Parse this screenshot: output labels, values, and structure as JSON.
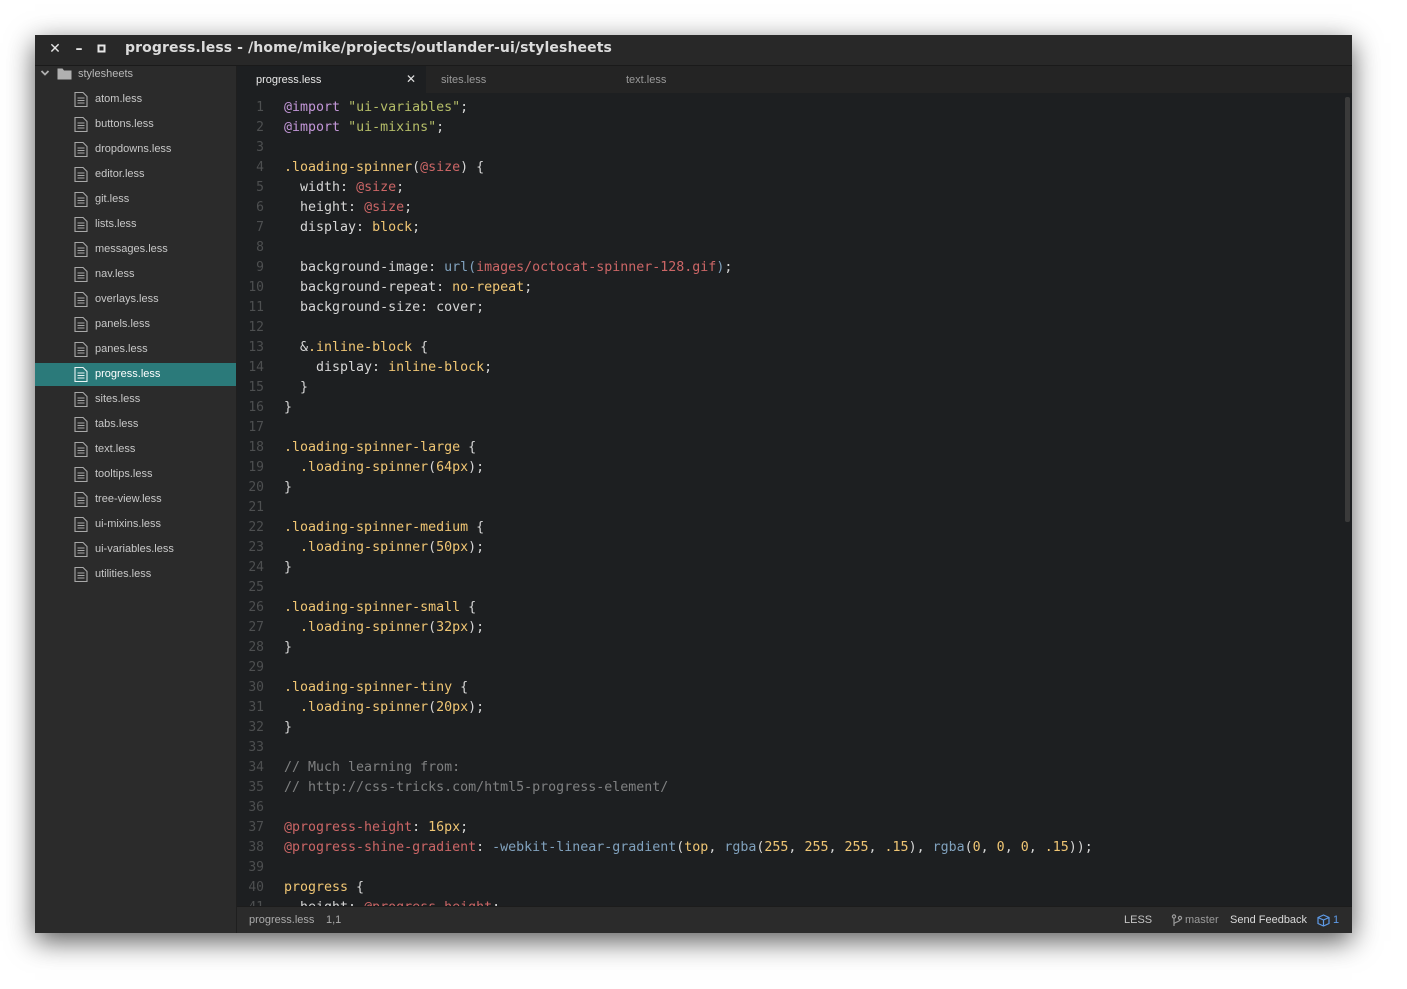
{
  "window": {
    "title": "progress.less - /home/mike/projects/outlander-ui/stylesheets",
    "controls": {
      "close": "✕",
      "minimize": "–",
      "maximize": "▫"
    }
  },
  "sidebar": {
    "folder": "stylesheets",
    "files": [
      {
        "label": "atom.less"
      },
      {
        "label": "buttons.less"
      },
      {
        "label": "dropdowns.less"
      },
      {
        "label": "editor.less"
      },
      {
        "label": "git.less"
      },
      {
        "label": "lists.less"
      },
      {
        "label": "messages.less"
      },
      {
        "label": "nav.less"
      },
      {
        "label": "overlays.less"
      },
      {
        "label": "panels.less"
      },
      {
        "label": "panes.less"
      },
      {
        "label": "progress.less",
        "selected": true
      },
      {
        "label": "sites.less"
      },
      {
        "label": "tabs.less"
      },
      {
        "label": "text.less"
      },
      {
        "label": "tooltips.less"
      },
      {
        "label": "tree-view.less"
      },
      {
        "label": "ui-mixins.less"
      },
      {
        "label": "ui-variables.less"
      },
      {
        "label": "utilities.less"
      }
    ]
  },
  "tabs": [
    {
      "label": "progress.less",
      "active": true,
      "close": "✕"
    },
    {
      "label": "sites.less"
    },
    {
      "label": "text.less"
    }
  ],
  "editor": {
    "colors": {
      "plain": "#d6d6d6",
      "at": "#c397d8",
      "string": "#b5bd68",
      "selector": "#f0c674",
      "variable": "#cc6666",
      "value": "#f0c674",
      "number": "#f0c674",
      "func": "#81a2be",
      "comment": "#7f8081",
      "url": "#cc6666"
    },
    "lines": [
      [
        [
          "at",
          "@import"
        ],
        [
          "plain",
          " "
        ],
        [
          "string",
          "\"ui-variables\""
        ],
        [
          "plain",
          ";"
        ]
      ],
      [
        [
          "at",
          "@import"
        ],
        [
          "plain",
          " "
        ],
        [
          "string",
          "\"ui-mixins\""
        ],
        [
          "plain",
          ";"
        ]
      ],
      [],
      [
        [
          "selector",
          ".loading-spinner"
        ],
        [
          "plain",
          "("
        ],
        [
          "variable",
          "@size"
        ],
        [
          "plain",
          ") {"
        ]
      ],
      [
        [
          "plain",
          "  width: "
        ],
        [
          "variable",
          "@size"
        ],
        [
          "plain",
          ";"
        ]
      ],
      [
        [
          "plain",
          "  height: "
        ],
        [
          "variable",
          "@size"
        ],
        [
          "plain",
          ";"
        ]
      ],
      [
        [
          "plain",
          "  display: "
        ],
        [
          "value",
          "block"
        ],
        [
          "plain",
          ";"
        ]
      ],
      [],
      [
        [
          "plain",
          "  background-image: "
        ],
        [
          "func",
          "url("
        ],
        [
          "url",
          "images/octocat-spinner-128.gif"
        ],
        [
          "func",
          ")"
        ],
        [
          "plain",
          ";"
        ]
      ],
      [
        [
          "plain",
          "  background-repeat: "
        ],
        [
          "value",
          "no-repeat"
        ],
        [
          "plain",
          ";"
        ]
      ],
      [
        [
          "plain",
          "  background-size: cover;"
        ]
      ],
      [],
      [
        [
          "plain",
          "  &"
        ],
        [
          "selector",
          ".inline-block"
        ],
        [
          "plain",
          " {"
        ]
      ],
      [
        [
          "plain",
          "    display: "
        ],
        [
          "value",
          "inline-block"
        ],
        [
          "plain",
          ";"
        ]
      ],
      [
        [
          "plain",
          "  }"
        ]
      ],
      [
        [
          "plain",
          "}"
        ]
      ],
      [],
      [
        [
          "selector",
          ".loading-spinner-large"
        ],
        [
          "plain",
          " {"
        ]
      ],
      [
        [
          "plain",
          "  "
        ],
        [
          "selector",
          ".loading-spinner"
        ],
        [
          "plain",
          "("
        ],
        [
          "number",
          "64px"
        ],
        [
          "plain",
          ");"
        ]
      ],
      [
        [
          "plain",
          "}"
        ]
      ],
      [],
      [
        [
          "selector",
          ".loading-spinner-medium"
        ],
        [
          "plain",
          " {"
        ]
      ],
      [
        [
          "plain",
          "  "
        ],
        [
          "selector",
          ".loading-spinner"
        ],
        [
          "plain",
          "("
        ],
        [
          "number",
          "50px"
        ],
        [
          "plain",
          ");"
        ]
      ],
      [
        [
          "plain",
          "}"
        ]
      ],
      [],
      [
        [
          "selector",
          ".loading-spinner-small"
        ],
        [
          "plain",
          " {"
        ]
      ],
      [
        [
          "plain",
          "  "
        ],
        [
          "selector",
          ".loading-spinner"
        ],
        [
          "plain",
          "("
        ],
        [
          "number",
          "32px"
        ],
        [
          "plain",
          ");"
        ]
      ],
      [
        [
          "plain",
          "}"
        ]
      ],
      [],
      [
        [
          "selector",
          ".loading-spinner-tiny"
        ],
        [
          "plain",
          " {"
        ]
      ],
      [
        [
          "plain",
          "  "
        ],
        [
          "selector",
          ".loading-spinner"
        ],
        [
          "plain",
          "("
        ],
        [
          "number",
          "20px"
        ],
        [
          "plain",
          ");"
        ]
      ],
      [
        [
          "plain",
          "}"
        ]
      ],
      [],
      [
        [
          "comment",
          "// Much learning from:"
        ]
      ],
      [
        [
          "comment",
          "// http://css-tricks.com/html5-progress-element/"
        ]
      ],
      [],
      [
        [
          "variable",
          "@progress-height"
        ],
        [
          "plain",
          ": "
        ],
        [
          "number",
          "16px"
        ],
        [
          "plain",
          ";"
        ]
      ],
      [
        [
          "variable",
          "@progress-shine-gradient"
        ],
        [
          "plain",
          ": "
        ],
        [
          "func",
          "-webkit-linear-gradient"
        ],
        [
          "plain",
          "("
        ],
        [
          "value",
          "top"
        ],
        [
          "plain",
          ", "
        ],
        [
          "func",
          "rgba"
        ],
        [
          "plain",
          "("
        ],
        [
          "number",
          "255"
        ],
        [
          "plain",
          ", "
        ],
        [
          "number",
          "255"
        ],
        [
          "plain",
          ", "
        ],
        [
          "number",
          "255"
        ],
        [
          "plain",
          ", "
        ],
        [
          "number",
          ".15"
        ],
        [
          "plain",
          "), "
        ],
        [
          "func",
          "rgba"
        ],
        [
          "plain",
          "("
        ],
        [
          "number",
          "0"
        ],
        [
          "plain",
          ", "
        ],
        [
          "number",
          "0"
        ],
        [
          "plain",
          ", "
        ],
        [
          "number",
          "0"
        ],
        [
          "plain",
          ", "
        ],
        [
          "number",
          ".15"
        ],
        [
          "plain",
          "));"
        ]
      ],
      [],
      [
        [
          "selector",
          "progress"
        ],
        [
          "plain",
          " {"
        ]
      ],
      [
        [
          "plain",
          "  height: "
        ],
        [
          "variable",
          "@progress-height"
        ],
        [
          "plain",
          ";"
        ]
      ]
    ]
  },
  "status": {
    "file": "progress.less",
    "cursor": "1,1",
    "grammar": "LESS",
    "branch": "master",
    "feedback": "Send Feedback",
    "updates": "1"
  }
}
